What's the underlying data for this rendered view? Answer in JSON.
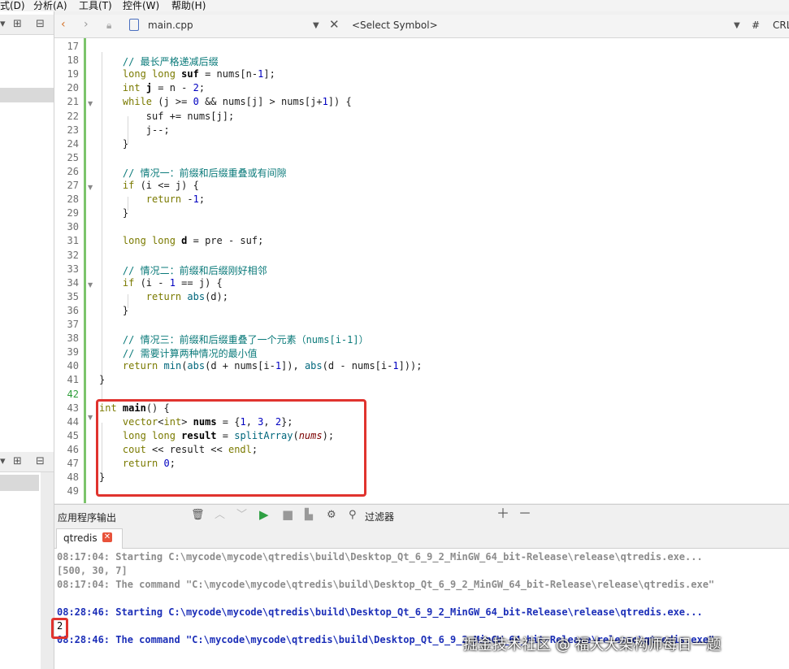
{
  "menubar": {
    "items": [
      "式(D)",
      "分析(A)",
      "工具(T)",
      "控件(W)",
      "帮助(H)"
    ]
  },
  "editor_toolbar": {
    "file_name": "main.cpp",
    "symbol_placeholder": "<Select Symbol>",
    "hash": "#",
    "line_ending": "CRL"
  },
  "code_lines": [
    {
      "n": "17",
      "html": ""
    },
    {
      "n": "18",
      "html": "    <span class=\"cm\">// 最长严格递减后缀</span>"
    },
    {
      "n": "19",
      "html": "    <span class=\"kw\">long long</span> <span class=\"bd\">suf</span> = nums[n-<span class=\"nm\">1</span>];"
    },
    {
      "n": "20",
      "html": "    <span class=\"kw\">int</span> <span class=\"bd\">j</span> = n - <span class=\"nm\">2</span>;"
    },
    {
      "n": "21",
      "html": "    <span class=\"kw\">while</span> (j >= <span class=\"nm\">0</span> && nums[j] > nums[j+<span class=\"nm\">1</span>]) {"
    },
    {
      "n": "22",
      "html": "        suf += nums[j];"
    },
    {
      "n": "23",
      "html": "        j--;"
    },
    {
      "n": "24",
      "html": "    }"
    },
    {
      "n": "25",
      "html": ""
    },
    {
      "n": "26",
      "html": "    <span class=\"cm\">// 情况一：前缀和后缀重叠或有间隙</span>"
    },
    {
      "n": "27",
      "html": "    <span class=\"kw\">if</span> (i <= j) {"
    },
    {
      "n": "28",
      "html": "        <span class=\"kw\">return</span> -<span class=\"nm\">1</span>;"
    },
    {
      "n": "29",
      "html": "    }"
    },
    {
      "n": "30",
      "html": ""
    },
    {
      "n": "31",
      "html": "    <span class=\"kw\">long long</span> <span class=\"bd\">d</span> = pre - suf;"
    },
    {
      "n": "32",
      "html": ""
    },
    {
      "n": "33",
      "html": "    <span class=\"cm\">// 情况二：前缀和后缀刚好相邻</span>"
    },
    {
      "n": "34",
      "html": "    <span class=\"kw\">if</span> (i - <span class=\"nm\">1</span> == j) {"
    },
    {
      "n": "35",
      "html": "        <span class=\"kw\">return</span> <span class=\"fn\">abs</span>(d);"
    },
    {
      "n": "36",
      "html": "    }"
    },
    {
      "n": "37",
      "html": ""
    },
    {
      "n": "38",
      "html": "    <span class=\"cm\">// 情况三：前缀和后缀重叠了一个元素（nums[i-1]）</span>"
    },
    {
      "n": "39",
      "html": "    <span class=\"cm\">// 需要计算两种情况的最小值</span>"
    },
    {
      "n": "40",
      "html": "    <span class=\"kw\">return</span> <span class=\"fn\">min</span>(<span class=\"fn\">abs</span>(d + nums[i-<span class=\"nm\">1</span>]), <span class=\"fn\">abs</span>(d - nums[i-<span class=\"nm\">1</span>]));"
    },
    {
      "n": "41",
      "html": "}"
    },
    {
      "n": "42",
      "html": ""
    },
    {
      "n": "43",
      "html": "<span class=\"kw\">int</span> <span class=\"bd\">main</span>() {"
    },
    {
      "n": "44",
      "html": "    <span class=\"kw\">vector</span><<span class=\"kw\">int</span>> <span class=\"bd\">nums</span> = {<span class=\"nm\">1</span>, <span class=\"nm\">3</span>, <span class=\"nm\">2</span>};"
    },
    {
      "n": "45",
      "html": "    <span class=\"kw\">long long</span> <span class=\"bd\">result</span> = <span class=\"fn\">splitArray</span>(<span class=\"it\">nums</span>);"
    },
    {
      "n": "46",
      "html": "    <span class=\"kw\">cout</span> << result << <span class=\"kw\">endl</span>;"
    },
    {
      "n": "47",
      "html": "    <span class=\"kw\">return</span> <span class=\"nm\">0</span>;"
    },
    {
      "n": "48",
      "html": "}"
    },
    {
      "n": "49",
      "html": ""
    }
  ],
  "output": {
    "panel_title": "应用程序输出",
    "filter_label": "过滤器",
    "tab_label": "qtredis",
    "lines": [
      {
        "text": "08:17:04: Starting C:\\mycode\\mycode\\qtredis\\build\\Desktop_Qt_6_9_2_MinGW_64_bit-Release\\release\\qtredis.exe...",
        "style": "gray"
      },
      {
        "text": "[500, 30, 7]",
        "style": "gray"
      },
      {
        "text": "08:17:04: The command \"C:\\mycode\\mycode\\qtredis\\build\\Desktop_Qt_6_9_2_MinGW_64_bit-Release\\release\\qtredis.exe\"",
        "style": "gray"
      },
      {
        "text": "",
        "style": "gray"
      },
      {
        "text": "08:28:46: Starting C:\\mycode\\mycode\\qtredis\\build\\Desktop_Qt_6_9_2_MinGW_64_bit-Release\\release\\qtredis.exe...",
        "style": "blue"
      },
      {
        "text": "2",
        "style": "black"
      },
      {
        "text": "08:28:46: The command \"C:\\mycode\\mycode\\qtredis\\build\\Desktop_Qt_6_9_2_MinGW_64_bit-Release\\release\\qtredis.exe\"",
        "style": "blue"
      }
    ]
  },
  "watermark": "掘金技术社区 @ 福大大架构师每日一题"
}
